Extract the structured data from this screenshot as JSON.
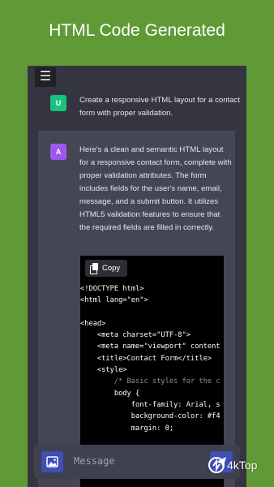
{
  "headline": "HTML Code Generated",
  "user": {
    "avatar_letter": "U",
    "message": "Create a responsive HTML layout for a contact form with proper validation."
  },
  "assistant": {
    "avatar_letter": "A",
    "message": "Here's a clean and semantic HTML layout for a responsive contact form, complete with proper validation attributes. The form includes fields for the user's name, email, message, and a submit button. It utilizes HTML5 validation features to ensure that the required fields are filled in correctly."
  },
  "code_block": {
    "copy_label": "Copy",
    "lines": [
      "<!DOCTYPE html>",
      "<html lang=\"en\">",
      "",
      "<head>",
      "    <meta charset=\"UTF-8\">",
      "    <meta name=\"viewport\" content",
      "    <title>Contact Form</title>",
      "    <style>",
      "        /* Basic styles for the c",
      "        body {",
      "            font-family: Arial, s",
      "            background-color: #f4",
      "            margin: 0;"
    ]
  },
  "composer": {
    "placeholder": "Message"
  },
  "watermark": {
    "text": "4kTop"
  },
  "colors": {
    "page_bg": "#5f9a36",
    "chat_bg": "#343541",
    "assistant_bg": "#444654",
    "user_avatar": "#19c37d",
    "assistant_avatar": "#9b59f2",
    "button_accent": "#3e4fb5"
  },
  "icons": {
    "menu": "hamburger-menu-icon",
    "copy": "copy-icon",
    "image": "image-icon",
    "send": "send-icon"
  }
}
